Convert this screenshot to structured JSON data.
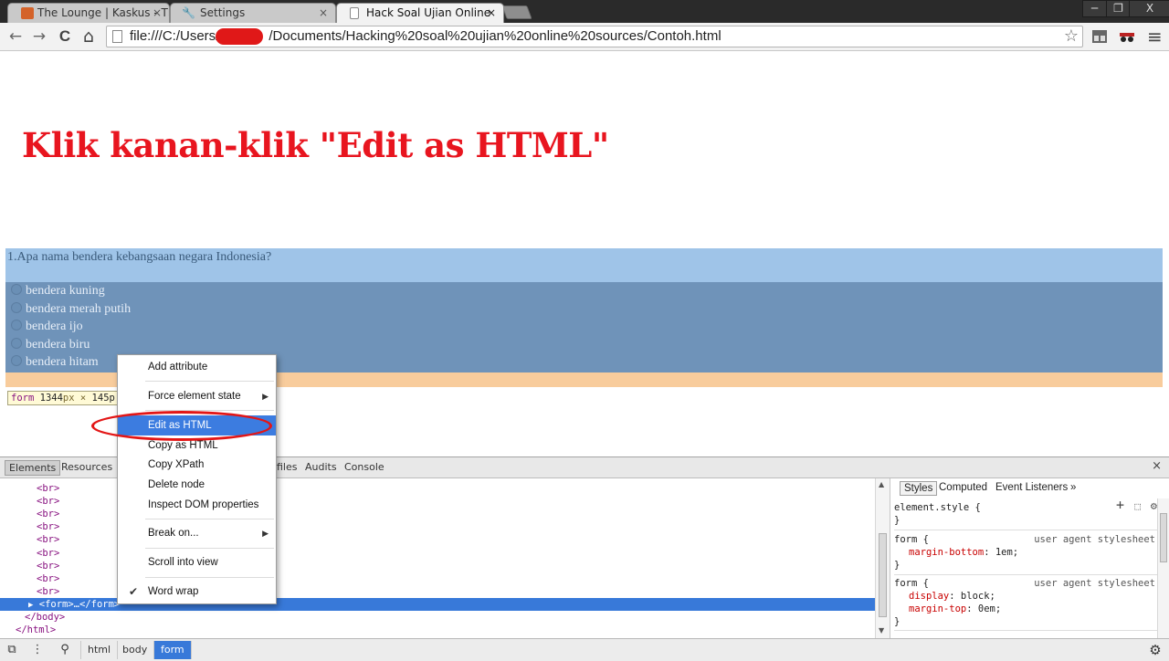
{
  "browser": {
    "tabs": [
      {
        "title": "The Lounge | Kaskus - The",
        "close": "×"
      },
      {
        "title": "Settings",
        "close": "×"
      },
      {
        "title": "Hack Soal Ujian Online",
        "close": "×"
      }
    ],
    "window_buttons": {
      "minimize": "─",
      "restore": "❐",
      "close": "X"
    },
    "nav": {
      "back": "←",
      "forward": "→",
      "reload": "C",
      "home": "⌂"
    },
    "url_before": "file:///C:/Users/",
    "url_after": "/Documents/Hacking%20soal%20ujian%20online%20sources/Contoh.html",
    "star": "☆",
    "menu_icon": "≡"
  },
  "page": {
    "headline": "Klik kanan-klik \"Edit as HTML\"",
    "question": "1.Apa nama bendera kebangsaan negara Indonesia?",
    "options": [
      "bendera kuning",
      "bendera merah putih",
      "bendera ijo",
      "bendera biru",
      "bendera hitam"
    ],
    "tooltip": {
      "tag": "form",
      "w": "1344",
      "px": "px",
      "x": " × ",
      "h": "145p"
    }
  },
  "devtools": {
    "tabs": [
      "Elements",
      "Resources",
      "files",
      "Audits",
      "Console"
    ],
    "close": "×",
    "dom_lines": [
      "<br>",
      "<br>",
      "<br>",
      "<br>",
      "<br>",
      "<br>",
      "<br>",
      "<br>",
      "<br>"
    ],
    "selected_line": "<form>…</form>",
    "after_lines": [
      "</body>",
      "</html>"
    ],
    "styles_tabs": [
      "Styles",
      "Computed",
      "Event Listeners",
      "»"
    ],
    "rules": [
      {
        "selector": "element.style {",
        "source": "",
        "props": [],
        "close": "}"
      },
      {
        "selector": "form {",
        "source": "user agent stylesheet",
        "props": [
          {
            "name": "margin-bottom",
            "value": "1em;"
          }
        ],
        "close": "}"
      },
      {
        "selector": "form {",
        "source": "user agent stylesheet",
        "props": [
          {
            "name": "display",
            "value": "block;"
          },
          {
            "name": "margin-top",
            "value": "0em;"
          }
        ],
        "close": "}"
      }
    ],
    "breadcrumbs": [
      "html",
      "body",
      "form"
    ]
  },
  "context_menu": {
    "items": [
      "Add attribute",
      "Force element state",
      "Edit as HTML",
      "Copy as HTML",
      "Copy XPath",
      "Delete node",
      "Inspect DOM properties",
      "Break on...",
      "Scroll into view",
      "Word wrap"
    ],
    "highlighted": "Edit as HTML"
  },
  "colors": {
    "headline": "#e8151f",
    "highlight": "#3c7ce0",
    "annotation": "#e31616"
  }
}
